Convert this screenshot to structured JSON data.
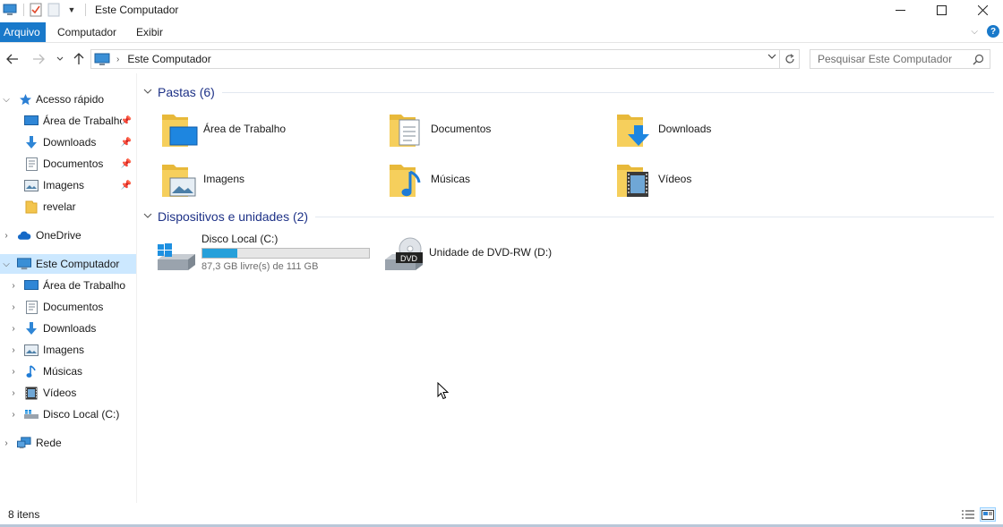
{
  "window": {
    "title": "Este Computador",
    "controls": {
      "minimize": "—",
      "maximize": "☐",
      "close": "✕"
    }
  },
  "ribbon": {
    "tabs": [
      "Arquivo",
      "Computador",
      "Exibir"
    ]
  },
  "address": {
    "path": "Este Computador",
    "search_placeholder": "Pesquisar Este Computador"
  },
  "sidebar": {
    "items": [
      {
        "label": "Acesso rápido",
        "icon": "star-icon"
      },
      {
        "label": "Área de Trabalho",
        "icon": "desktop-icon",
        "pinned": true
      },
      {
        "label": "Downloads",
        "icon": "download-arrow-icon",
        "pinned": true
      },
      {
        "label": "Documentos",
        "icon": "document-icon",
        "pinned": true
      },
      {
        "label": "Imagens",
        "icon": "picture-icon",
        "pinned": true
      },
      {
        "label": "revelar",
        "icon": "folder-icon"
      },
      {
        "label": "OneDrive",
        "icon": "cloud-icon"
      },
      {
        "label": "Este Computador",
        "icon": "computer-icon",
        "selected": true
      },
      {
        "label": "Área de Trabalho",
        "icon": "desktop-icon"
      },
      {
        "label": "Documentos",
        "icon": "document-icon"
      },
      {
        "label": "Downloads",
        "icon": "download-arrow-icon"
      },
      {
        "label": "Imagens",
        "icon": "picture-icon"
      },
      {
        "label": "Músicas",
        "icon": "music-note-icon"
      },
      {
        "label": "Vídeos",
        "icon": "film-icon"
      },
      {
        "label": "Disco Local (C:)",
        "icon": "drive-icon"
      },
      {
        "label": "Rede",
        "icon": "network-icon"
      }
    ]
  },
  "main": {
    "folders_header": "Pastas (6)",
    "folders": [
      {
        "label": "Área de Trabalho",
        "icon": "desktop-folder-icon"
      },
      {
        "label": "Documentos",
        "icon": "documents-folder-icon"
      },
      {
        "label": "Downloads",
        "icon": "downloads-folder-icon"
      },
      {
        "label": "Imagens",
        "icon": "pictures-folder-icon"
      },
      {
        "label": "Músicas",
        "icon": "music-folder-icon"
      },
      {
        "label": "Vídeos",
        "icon": "videos-folder-icon"
      }
    ],
    "devices_header": "Dispositivos e unidades (2)",
    "drives": [
      {
        "label": "Disco Local (C:)",
        "free_text": "87,3 GB livre(s) de 111 GB",
        "used_fraction": 0.21,
        "icon": "windows-drive-icon"
      },
      {
        "label": "Unidade de DVD-RW (D:)",
        "icon": "dvd-drive-icon",
        "badge": "DVD"
      }
    ]
  },
  "status": {
    "item_count": "8 itens"
  },
  "colors": {
    "accent": "#1979ca",
    "selection": "#cce8ff",
    "group_title": "#1e3287",
    "drive_fill": "#26a0da",
    "folder": "#f3c54d"
  }
}
